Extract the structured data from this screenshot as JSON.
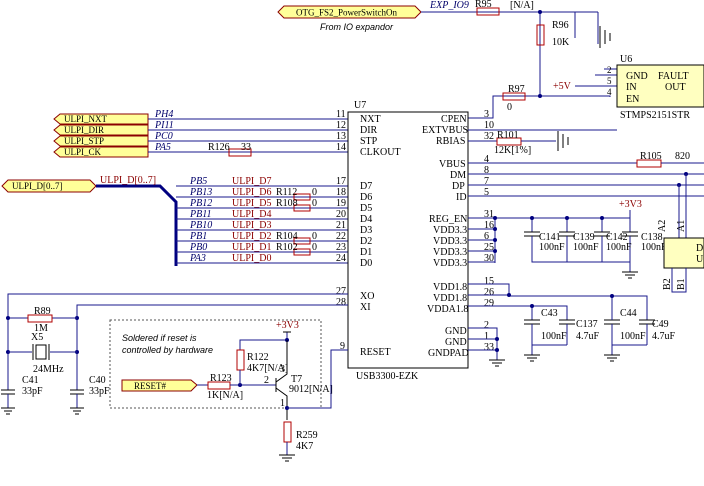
{
  "ports": {
    "otg": "OTG_FS2_PowerSwitchOn",
    "nxt": "ULPI_NXT",
    "dir": "ULPI_DIR",
    "stp": "ULPI_STP",
    "ck": "ULPI_CK",
    "data": "ULPI_D[0..7]",
    "reset": "RESET#"
  },
  "notes": {
    "from_io": "From IO expandor",
    "soldered_1": "Soldered if reset is",
    "soldered_2": "controlled by hardware"
  },
  "bus_label": "ULPI_D[0..7]",
  "nets": {
    "exp_io9": "EXP_IO9",
    "ph4": "PH4",
    "pi11": "PI11",
    "pc0": "PC0",
    "pa5": "PA5",
    "pb5": "PB5",
    "pb13": "PB13",
    "pb12": "PB12",
    "pb11": "PB11",
    "pb10": "PB10",
    "pb1": "PB1",
    "pb0": "PB0",
    "pa3": "PA3",
    "d7": "ULPI_D7",
    "d6": "ULPI_D6",
    "d5": "ULPI_D5",
    "d4": "ULPI_D4",
    "d3": "ULPI_D3",
    "d2": "ULPI_D2",
    "d1": "ULPI_D1",
    "d0": "ULPI_D0",
    "p5v": "+5V",
    "p3v3a": "+3V3",
    "p3v3b": "+3V3"
  },
  "u7": {
    "ref": "U7",
    "part": "USB3300-EZK",
    "left_pins": [
      {
        "num": "11",
        "name": "NXT"
      },
      {
        "num": "12",
        "name": "DIR"
      },
      {
        "num": "13",
        "name": "STP"
      },
      {
        "num": "14",
        "name": "CLKOUT"
      },
      {
        "num": "17",
        "name": "D7"
      },
      {
        "num": "18",
        "name": "D6"
      },
      {
        "num": "19",
        "name": "D5"
      },
      {
        "num": "20",
        "name": "D4"
      },
      {
        "num": "21",
        "name": "D3"
      },
      {
        "num": "22",
        "name": "D2"
      },
      {
        "num": "23",
        "name": "D1"
      },
      {
        "num": "24",
        "name": "D0"
      },
      {
        "num": "27",
        "name": "XO"
      },
      {
        "num": "28",
        "name": "XI"
      },
      {
        "num": "9",
        "name": "RESET"
      }
    ],
    "right_pins": [
      {
        "num": "3",
        "name": "CPEN"
      },
      {
        "num": "10",
        "name": "EXTVBUS"
      },
      {
        "num": "32",
        "name": "RBIAS"
      },
      {
        "num": "4",
        "name": "VBUS"
      },
      {
        "num": "8",
        "name": "DM"
      },
      {
        "num": "7",
        "name": "DP"
      },
      {
        "num": "5",
        "name": "ID"
      },
      {
        "num": "31",
        "name": "REG_EN"
      },
      {
        "num": "16",
        "name": "VDD3.3"
      },
      {
        "num": "6",
        "name": "VDD3.3"
      },
      {
        "num": "25",
        "name": "VDD3.3"
      },
      {
        "num": "30",
        "name": "VDD3.3"
      },
      {
        "num": "15",
        "name": "VDD1.8"
      },
      {
        "num": "26",
        "name": "VDD1.8"
      },
      {
        "num": "29",
        "name": "VDDA1.8"
      },
      {
        "num": "2",
        "name": "GND"
      },
      {
        "num": "1",
        "name": "GND"
      },
      {
        "num": "33",
        "name": "GNDPAD"
      }
    ]
  },
  "u6": {
    "ref": "U6",
    "part": "STMPS2151STR",
    "left_pins": [
      {
        "num": "2",
        "name": "GND"
      },
      {
        "num": "5",
        "name": "IN"
      },
      {
        "num": "4",
        "name": "EN"
      }
    ],
    "right_pins": [
      {
        "name": "FAULT"
      },
      {
        "name": "OUT"
      }
    ]
  },
  "resistors": {
    "r95": {
      "ref": "R95",
      "val": "[N/A]"
    },
    "r96": {
      "ref": "R96",
      "val": "10K"
    },
    "r97": {
      "ref": "R97",
      "val": "0"
    },
    "r101": {
      "ref": "R101",
      "val": "12K[1%]"
    },
    "r105": {
      "ref": "R105",
      "val": "820"
    },
    "r126": {
      "ref": "R126",
      "val": "33"
    },
    "r112": {
      "ref": "R112",
      "val": "0"
    },
    "r108": {
      "ref": "R108",
      "val": "0"
    },
    "r104": {
      "ref": "R104",
      "val": "0"
    },
    "r102": {
      "ref": "R102",
      "val": "0"
    },
    "r89": {
      "ref": "R89",
      "val": "1M"
    },
    "r122": {
      "ref": "R122",
      "val": "4K7[N/A]"
    },
    "r123": {
      "ref": "R123",
      "val": "1K[N/A]"
    },
    "r259": {
      "ref": "R259",
      "val": "4K7"
    }
  },
  "caps": {
    "c141": {
      "ref": "C141",
      "val": "100nF"
    },
    "c139": {
      "ref": "C139",
      "val": "100nF"
    },
    "c142": {
      "ref": "C142",
      "val": "100nF"
    },
    "c138": {
      "ref": "C138",
      "val": "100nF"
    },
    "c43": {
      "ref": "C43",
      "val": "100nF"
    },
    "c137": {
      "ref": "C137",
      "val": "4.7uF"
    },
    "c44": {
      "ref": "C44",
      "val": "100nF"
    },
    "c49": {
      "ref": "C49",
      "val": "4.7uF"
    },
    "c41": {
      "ref": "C41",
      "val": "33pF"
    },
    "c40": {
      "ref": "C40",
      "val": "33pF"
    }
  },
  "crystal": {
    "ref": "X5",
    "val": "24MHz"
  },
  "transistor": {
    "ref": "T7",
    "val": "9012[N/A]",
    "pin_1": "1",
    "pin_2": "2",
    "pin_3": "3"
  },
  "edge_part": {
    "a2": "A2",
    "a1": "A1",
    "b2": "B2",
    "b1": "B1",
    "d": "D",
    "u": "U"
  }
}
